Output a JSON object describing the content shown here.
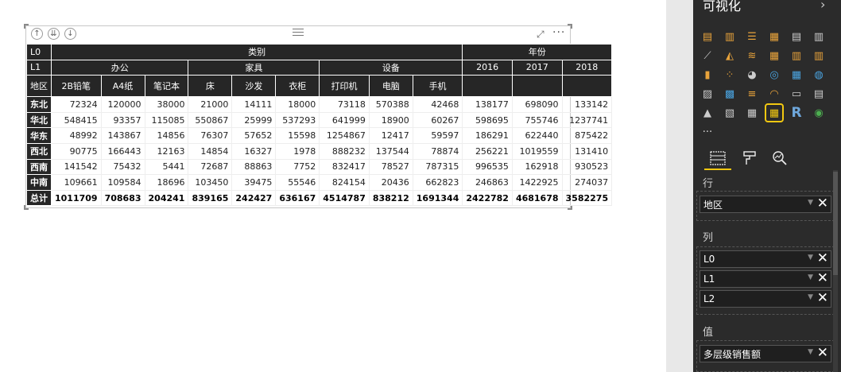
{
  "matrix": {
    "level_labels": [
      "L0",
      "L1",
      "地区"
    ],
    "l0_groups": [
      "类别",
      "年份"
    ],
    "l1_groups": [
      "办公",
      "家具",
      "设备",
      "2016",
      "2017",
      "2018"
    ],
    "l2_columns": [
      "2B铅笔",
      "A4纸",
      "笔记本",
      "床",
      "沙发",
      "衣柜",
      "打印机",
      "电脑",
      "手机"
    ],
    "rows": [
      {
        "region": "东北",
        "values": [
          "72324",
          "120000",
          "38000",
          "21000",
          "14111",
          "18000",
          "73118",
          "570388",
          "42468",
          "138177",
          "698090",
          "133142"
        ]
      },
      {
        "region": "华北",
        "values": [
          "548415",
          "93357",
          "115085",
          "550867",
          "25999",
          "537293",
          "641999",
          "18900",
          "60267",
          "598695",
          "755746",
          "1237741"
        ]
      },
      {
        "region": "华东",
        "values": [
          "48992",
          "143867",
          "14856",
          "76307",
          "57652",
          "15598",
          "1254867",
          "12417",
          "59597",
          "186291",
          "622440",
          "875422"
        ]
      },
      {
        "region": "西北",
        "values": [
          "90775",
          "166443",
          "12163",
          "14854",
          "16327",
          "1978",
          "888232",
          "137544",
          "78874",
          "256221",
          "1019559",
          "131410"
        ]
      },
      {
        "region": "西南",
        "values": [
          "141542",
          "75432",
          "5441",
          "72687",
          "88863",
          "7752",
          "832417",
          "78527",
          "787315",
          "996535",
          "162918",
          "930523"
        ]
      },
      {
        "region": "中南",
        "values": [
          "109661",
          "109584",
          "18696",
          "103450",
          "39475",
          "55546",
          "824154",
          "20436",
          "662823",
          "246863",
          "1422925",
          "274037"
        ]
      }
    ],
    "total": {
      "label": "总计",
      "values": [
        "1011709",
        "708683",
        "204241",
        "839165",
        "242427",
        "636167",
        "4514787",
        "838212",
        "1691344",
        "2422782",
        "4681678",
        "3582275"
      ]
    }
  },
  "visual_header": {
    "more_label": "···"
  },
  "pane": {
    "title": "可视化",
    "more_dots": "···",
    "rows_label": "行",
    "columns_label": "列",
    "values_label": "值",
    "rows_fields": [
      "地区"
    ],
    "column_fields": [
      "L0",
      "L1",
      "L2"
    ],
    "value_fields": [
      "多层级销售额"
    ],
    "accent_color": "#f2c811"
  }
}
